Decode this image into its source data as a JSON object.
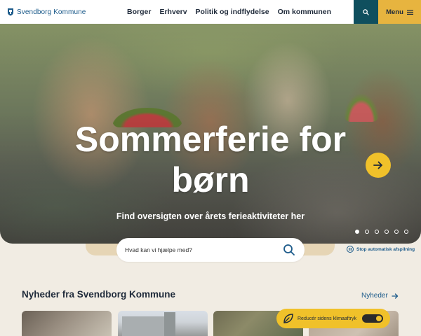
{
  "header": {
    "logo_text": "Svendborg Kommune",
    "nav": [
      "Borger",
      "Erhverv",
      "Politik og indflydelse",
      "Om kommunen"
    ],
    "menu_label": "Menu"
  },
  "hero": {
    "title_line1": "Sommerferie for",
    "title_line2": "børn",
    "subtitle": "Find oversigten over årets ferieaktiviteter her",
    "slide_count": 6,
    "active_slide": 1
  },
  "search": {
    "placeholder": "Hvad kan vi hjælpe med?"
  },
  "carousel_control": {
    "stop_label": "Stop automatisk afspilning"
  },
  "news": {
    "title": "Nyheder fra Svendborg Kommune",
    "link_label": "Nyheder"
  },
  "climate": {
    "label": "Reducér sidens klimaaftryk",
    "toggle_on": true
  },
  "colors": {
    "brand_blue": "#1b5a8a",
    "dark_teal": "#0f4f5e",
    "accent_yellow": "#f0c12a",
    "menu_gold": "#e7b43f",
    "page_bg": "#f1ece3"
  },
  "icons": {
    "logo": "crest-icon",
    "search": "search-icon",
    "menu": "hamburger-icon",
    "hero_next": "arrow-right-icon",
    "stop": "pause-icon",
    "news_link": "arrow-right-icon",
    "climate": "leaf-icon"
  }
}
